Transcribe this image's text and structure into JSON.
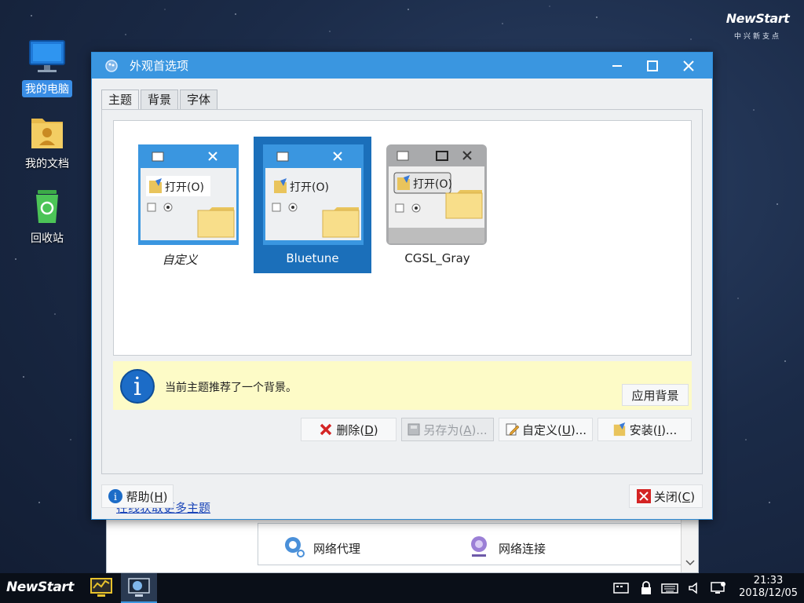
{
  "brand": {
    "logo": "NewStart",
    "logo_sub": "中兴新支点"
  },
  "desktop": {
    "icons": [
      {
        "label": "我的电脑",
        "icon": "computer-icon",
        "selected": true
      },
      {
        "label": "我的文档",
        "icon": "documents-folder-icon",
        "selected": false
      },
      {
        "label": "回收站",
        "icon": "recycle-bin-icon",
        "selected": false
      }
    ]
  },
  "background_window": {
    "items": [
      {
        "label": "网络代理",
        "icon": "network-proxy-icon"
      },
      {
        "label": "网络连接",
        "icon": "network-connection-icon"
      }
    ]
  },
  "dialog": {
    "title": "外观首选项",
    "tabs": [
      {
        "label": "主题",
        "active": true
      },
      {
        "label": "背景",
        "active": false
      },
      {
        "label": "字体",
        "active": false
      }
    ],
    "themes": [
      {
        "name": "自定义",
        "selected": false,
        "preview_open": "打开(O)"
      },
      {
        "name": "Bluetune",
        "selected": true,
        "preview_open": "打开(O)"
      },
      {
        "name": "CGSL_Gray",
        "selected": false,
        "preview_open": "打开(O)"
      }
    ],
    "info": {
      "text": "当前主题推荐了一个背景。",
      "apply_button": "应用背景"
    },
    "buttons": {
      "delete": {
        "text": "删除(",
        "key": "D",
        "end": ")"
      },
      "save_as": {
        "text": "另存为(",
        "key": "A",
        "end": ")..."
      },
      "customize": {
        "text": "自定义(",
        "key": "U",
        "end": ")..."
      },
      "install": {
        "text": "安装(",
        "key": "I",
        "end": ")..."
      }
    },
    "online_link": "在线获取更多主题",
    "help_button": {
      "text": "帮助(",
      "key": "H",
      "end": ")"
    },
    "close_button": {
      "text": "关闭(",
      "key": "C",
      "end": ")"
    }
  },
  "taskbar": {
    "start_label": "NewStart",
    "time": "21:33",
    "date": "2018/12/05"
  },
  "colors": {
    "accent": "#3a96e0",
    "selection": "#1b6fba",
    "info_background": "#fdfbc7"
  }
}
